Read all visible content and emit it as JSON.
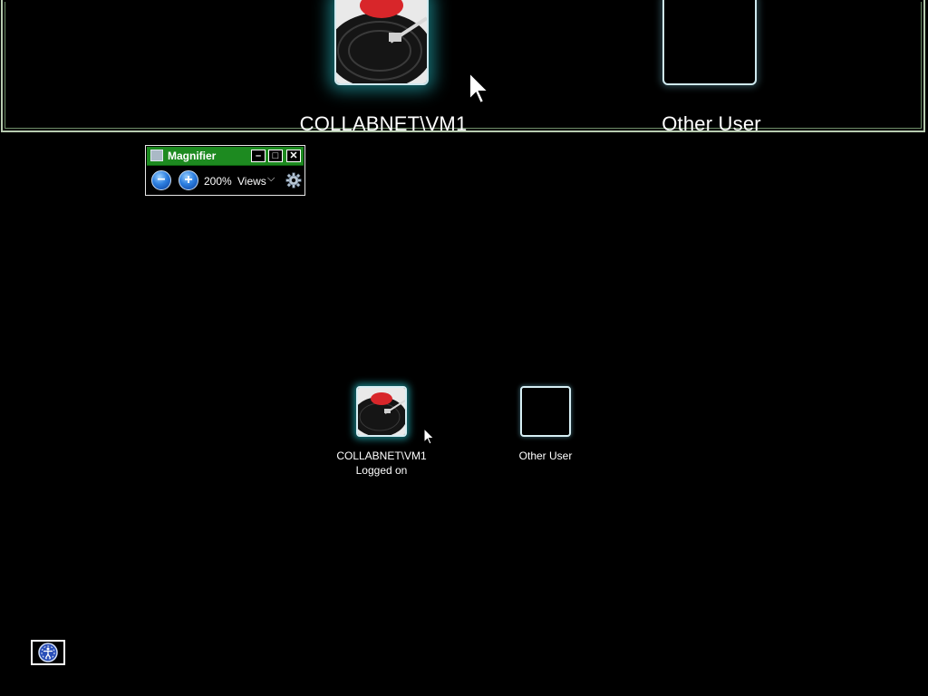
{
  "magnified_view": {
    "user_primary_label": "COLLABNET\\VM1",
    "user_other_label": "Other User"
  },
  "magnifier": {
    "title": "Magnifier",
    "minimize_symbol": "–",
    "maximize_symbol": "□",
    "close_symbol": "✕",
    "zoom_out_symbol": "−",
    "zoom_in_symbol": "+",
    "zoom_level": "200%",
    "views_label": "Views",
    "views_arrow": "⌵"
  },
  "users": [
    {
      "name": "COLLABNET\\VM1",
      "status": "Logged on",
      "selected": true
    },
    {
      "name": "Other User",
      "status": "",
      "selected": false
    }
  ],
  "ease_of_access": {
    "icon": "ease-of-access-icon"
  },
  "colors": {
    "title_bar": "#1d8a20",
    "glow": "#28c8d2",
    "record_label": "#d8262a"
  }
}
